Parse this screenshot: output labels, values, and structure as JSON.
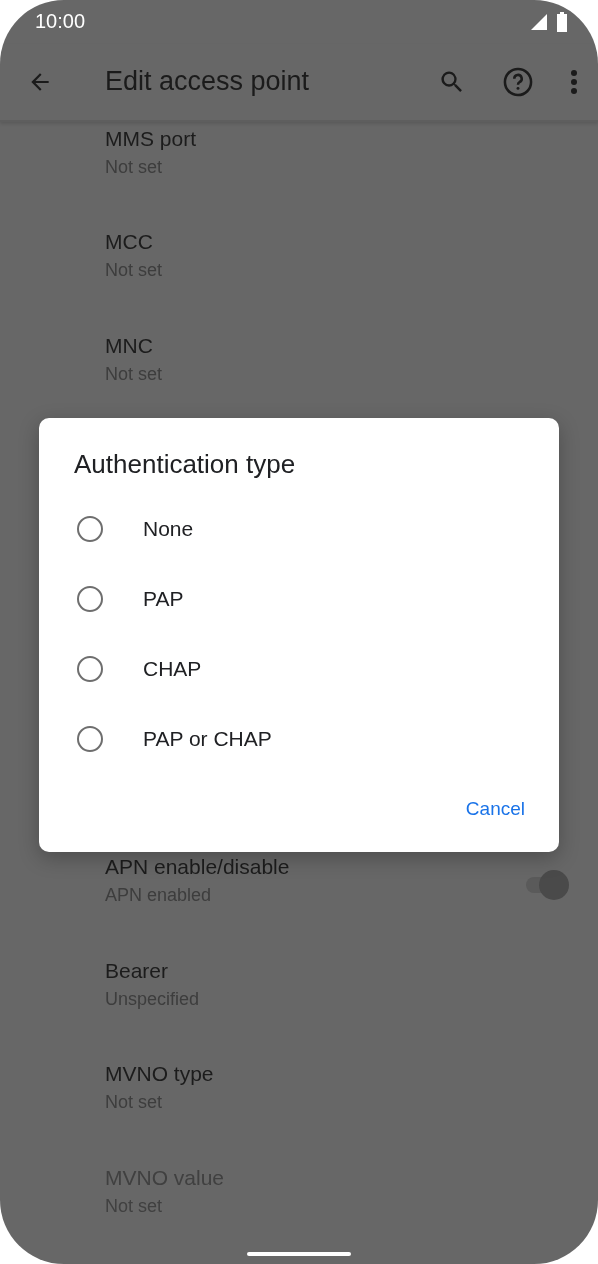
{
  "status_bar": {
    "time": "10:00"
  },
  "toolbar": {
    "title": "Edit access point"
  },
  "settings_above": [
    {
      "title": "MMS port",
      "summary": "Not set"
    },
    {
      "title": "MCC",
      "summary": "Not set"
    },
    {
      "title": "MNC",
      "summary": "Not set"
    }
  ],
  "settings_below": [
    {
      "kind": "switch",
      "title": "APN enable/disable",
      "summary": "APN enabled",
      "disabled": false,
      "on": true
    },
    {
      "kind": "text",
      "title": "Bearer",
      "summary": "Unspecified",
      "disabled": false
    },
    {
      "kind": "text",
      "title": "MVNO type",
      "summary": "Not set",
      "disabled": false
    },
    {
      "kind": "text",
      "title": "MVNO value",
      "summary": "Not set",
      "disabled": true
    }
  ],
  "dialog": {
    "title": "Authentication type",
    "options": [
      {
        "label": "None",
        "selected": false
      },
      {
        "label": "PAP",
        "selected": false
      },
      {
        "label": "CHAP",
        "selected": false
      },
      {
        "label": "PAP or CHAP",
        "selected": false
      }
    ],
    "buttons": [
      "Cancel"
    ]
  }
}
